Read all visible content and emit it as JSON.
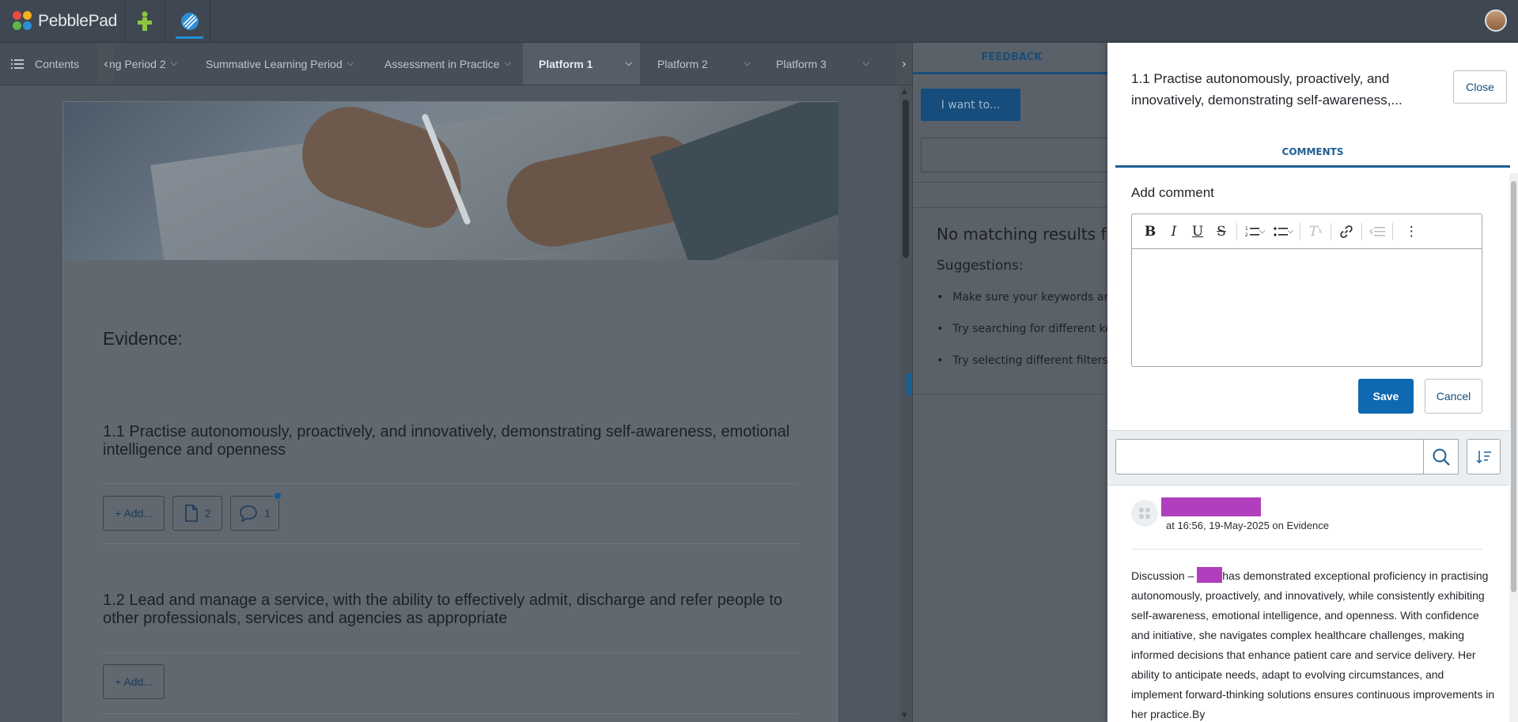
{
  "app": {
    "name": "PebblePad"
  },
  "header": {
    "logo_text": "PebblePad",
    "icons": [
      "add-icon",
      "workspace-icon",
      "avatar"
    ]
  },
  "tabs": {
    "contents_label": "Contents",
    "items": [
      {
        "label": "ng Period 2",
        "active": false
      },
      {
        "label": "Summative Learning Period",
        "active": false
      },
      {
        "label": "Assessment in Practice",
        "active": false
      },
      {
        "label": "Platform 1",
        "active": true
      },
      {
        "label": "Platform 2",
        "active": false
      },
      {
        "label": "Platform 3",
        "active": false
      }
    ]
  },
  "page": {
    "evidence_heading": "Evidence:",
    "items": [
      {
        "title": "1.1 Practise autonomously, proactively, and innovatively, demonstrating self-awareness, emotional intelligence and openness",
        "add_label": "+ Add...",
        "files_count": "2",
        "comments_count": "1"
      },
      {
        "title": "1.2 Lead and manage a service, with the ability to effectively admit, discharge and refer people to other professionals, services and agencies as appropriate",
        "add_label": "+ Add..."
      }
    ]
  },
  "feedback": {
    "tab_label": "FEEDBACK",
    "i_want_to": "I want to...",
    "no_results": "No matching results fo",
    "suggestions_label": "Suggestions:",
    "suggestions": [
      "Make sure your keywords are",
      "Try searching for different key",
      "Try selecting different filters."
    ]
  },
  "drawer": {
    "title": "1.1 Practise autonomously, proactively, and innovatively, demonstrating self-awareness,...",
    "close_label": "Close",
    "tab_label": "COMMENTS",
    "add_comment_label": "Add comment",
    "save_label": "Save",
    "cancel_label": "Cancel",
    "search_placeholder": "",
    "comment": {
      "meta": "at 16:56, 19-May-2025 on Evidence",
      "body_before": "Discussion – ",
      "body_after": "has demonstrated exceptional proficiency in practising autonomously, proactively, and innovatively, while consistently exhibiting self-awareness, emotional intelligence, and openness. With confidence and initiative, she navigates complex healthcare challenges, making informed decisions that enhance patient care and service delivery. Her ability to anticipate needs, adapt to evolving circumstances, and implement forward-thinking solutions ensures continuous improvements in her practice.By"
    }
  },
  "colors": {
    "accent": "#0f68b2",
    "redaction": "#b13fbd",
    "topbar": "#3f4752"
  }
}
